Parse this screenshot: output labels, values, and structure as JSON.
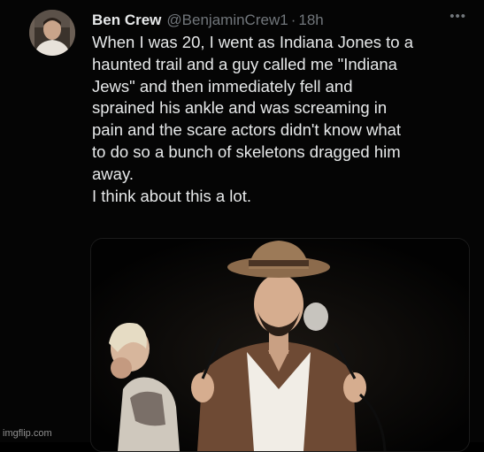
{
  "tweet": {
    "author_name": "Ben Crew",
    "handle": "@BenjaminCrew1",
    "separator": "·",
    "timestamp": "18h",
    "more_icon": "more-horizontal-icon",
    "lines": [
      "When I was 20, I went as Indiana Jones to a",
      "haunted trail and a guy called me \"Indiana",
      "Jews\" and then immediately fell and",
      "sprained his ankle and was screaming in",
      "pain and the scare actors didn't know what",
      "to do so a bunch of skeletons dragged him",
      "away.",
      "I think about this a lot."
    ]
  },
  "watermark": "imgflip.com",
  "colors": {
    "background": "#000000",
    "text_primary": "#e7e9ea",
    "text_secondary": "#71767b"
  }
}
